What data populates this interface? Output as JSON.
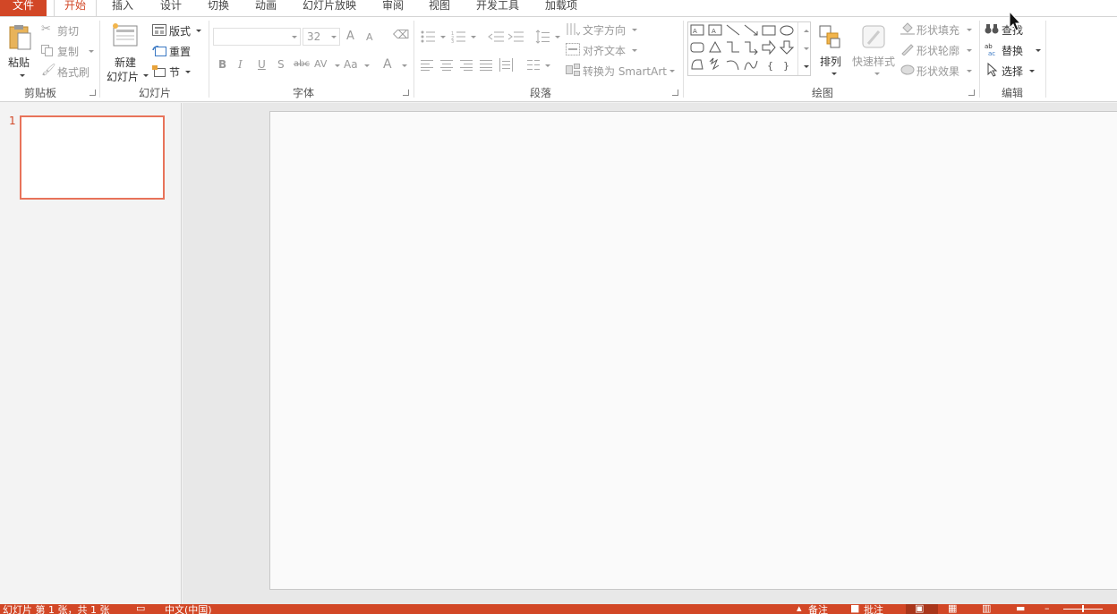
{
  "tabs": {
    "file": "文件",
    "home": "开始",
    "insert": "插入",
    "design": "设计",
    "transitions": "切换",
    "animations": "动画",
    "slideshow": "幻灯片放映",
    "review": "审阅",
    "view": "视图",
    "developer": "开发工具",
    "addins": "加载项"
  },
  "clipboard": {
    "paste": "粘贴",
    "cut": "剪切",
    "copy": "复制",
    "format_painter": "格式刷",
    "label": "剪贴板"
  },
  "slides": {
    "new_slide_line1": "新建",
    "new_slide_line2": "幻灯片",
    "layout": "版式",
    "reset": "重置",
    "section": "节",
    "label": "幻灯片"
  },
  "font": {
    "size": "32",
    "label": "字体",
    "bold": "B",
    "italic": "I",
    "underline": "U",
    "shadow": "S",
    "strike": "abc",
    "spacing": "AV",
    "case": "Aa",
    "color": "A",
    "grow": "A",
    "shrink": "A"
  },
  "paragraph": {
    "text_direction": "文字方向",
    "align_text": "对齐文本",
    "smartart": "转换为 SmartArt",
    "label": "段落"
  },
  "drawing": {
    "arrange": "排列",
    "quick_styles": "快速样式",
    "shape_fill": "形状填充",
    "shape_outline": "形状轮廓",
    "shape_effects": "形状效果",
    "label": "绘图"
  },
  "editing": {
    "find": "查找",
    "replace": "替换",
    "select": "选择",
    "label": "编辑"
  },
  "thumbnails": {
    "slide_number": "1"
  },
  "status": {
    "slide_info": "幻灯片 第 1 张，共 1 张",
    "language": "中文(中国)",
    "notes": "备注",
    "comments": "批注"
  },
  "colors": {
    "accent": "#d24726",
    "ribbon_bg": "#ffffff",
    "canvas_bg": "#fafafa",
    "thumb_border": "#e8735a"
  }
}
